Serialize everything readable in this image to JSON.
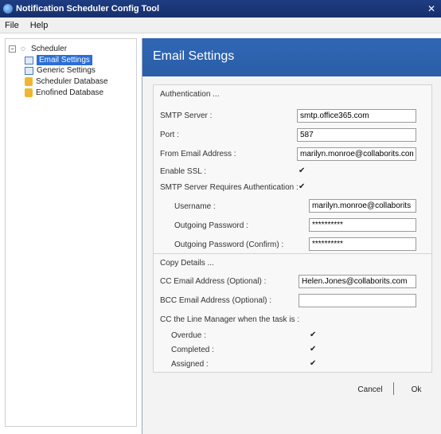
{
  "window": {
    "title": "Notification Scheduler Config Tool",
    "close_glyph": "✕"
  },
  "menu": [
    "File",
    "Help"
  ],
  "tree": {
    "root": "Scheduler",
    "items": [
      "Email Settings",
      "Generic Settings",
      "Scheduler Database",
      "Enofined Database"
    ]
  },
  "main": {
    "banner_title": "Email Settings",
    "authentication": {
      "title": "Authentication ...",
      "smtp_server_label": "SMTP Server :",
      "smtp_server_value": "smtp.office365.com",
      "port_label": "Port :",
      "port_value": "587",
      "from_email_label": "From Email Address :",
      "from_email_value": "marilyn.monroe@collaborits.com",
      "enable_ssl_label": "Enable SSL :",
      "smtp_requires_auth_label": "SMTP Server Requires Authentication :",
      "username_label": "Username :",
      "username_value": "marilyn.monroe@collaborits",
      "outgoing_password_label": "Outgoing Password :",
      "outgoing_password_value": "**********",
      "outgoing_password_confirm_label": "Outgoing Password (Confirm) :",
      "outgoing_password_confirm_value": "**********"
    },
    "copy_details": {
      "title": "Copy Details ...",
      "cc_label": "CC Email Address (Optional) :",
      "cc_value": "Helen.Jones@collaborits.com",
      "bcc_label": "BCC Email Address (Optional) :",
      "bcc_value": "",
      "line_manager_label": "CC the Line Manager when the task is :",
      "overdue_label": "Overdue :",
      "completed_label": "Completed :",
      "assigned_label": "Assigned :"
    },
    "buttons": {
      "cancel": "Cancel",
      "ok": "Ok"
    }
  }
}
